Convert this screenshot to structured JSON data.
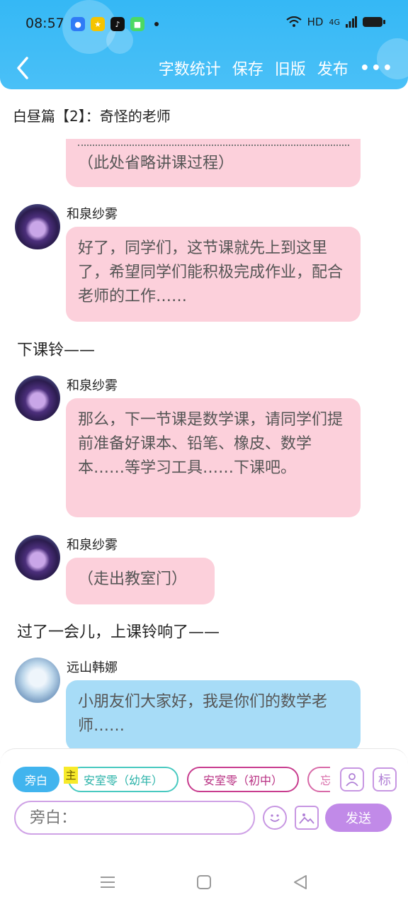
{
  "status_bar": {
    "time": "08:57",
    "network": "HD",
    "signal": "4G"
  },
  "toolbar": {
    "word_count": "字数统计",
    "save": "保存",
    "old_version": "旧版",
    "publish": "发布",
    "more": "•••"
  },
  "chapter_title": "白昼篇【2】：奇怪的老师",
  "messages": [
    {
      "type": "bubble",
      "text": "（此处省略讲课过程）"
    },
    {
      "type": "bubble",
      "speaker": "和泉纱雾",
      "text": "好了，同学们，这节课就先上到这里了，希望同学们能积极完成作业，配合老师的工作……"
    },
    {
      "type": "narration",
      "text": "下课铃——"
    },
    {
      "type": "bubble",
      "speaker": "和泉纱雾",
      "text": "那么，下一节课是数学课，请同学们提前准备好课本、铅笔、橡皮、数学本……等学习工具……下课吧。"
    },
    {
      "type": "bubble",
      "speaker": "和泉纱雾",
      "text": "（走出教室门）"
    },
    {
      "type": "narration",
      "text": "过了一会儿，上课铃响了——"
    },
    {
      "type": "bubble",
      "speaker": "远山韩娜",
      "text": "小朋友们大家好，我是你们的数学老师……"
    }
  ],
  "roles": {
    "narration": "旁白",
    "main_tag": "主",
    "role1": "安室零（幼年）",
    "role2": "安室零（初中）",
    "role3": "忘"
  },
  "input": {
    "placeholder": "旁白：",
    "send": "发送",
    "tag_button": "标"
  },
  "colors": {
    "header": "#35b8f5",
    "pink_bubble": "#fcd0db",
    "blue_bubble": "#a7dcf7",
    "send_button": "#c18ae8"
  }
}
